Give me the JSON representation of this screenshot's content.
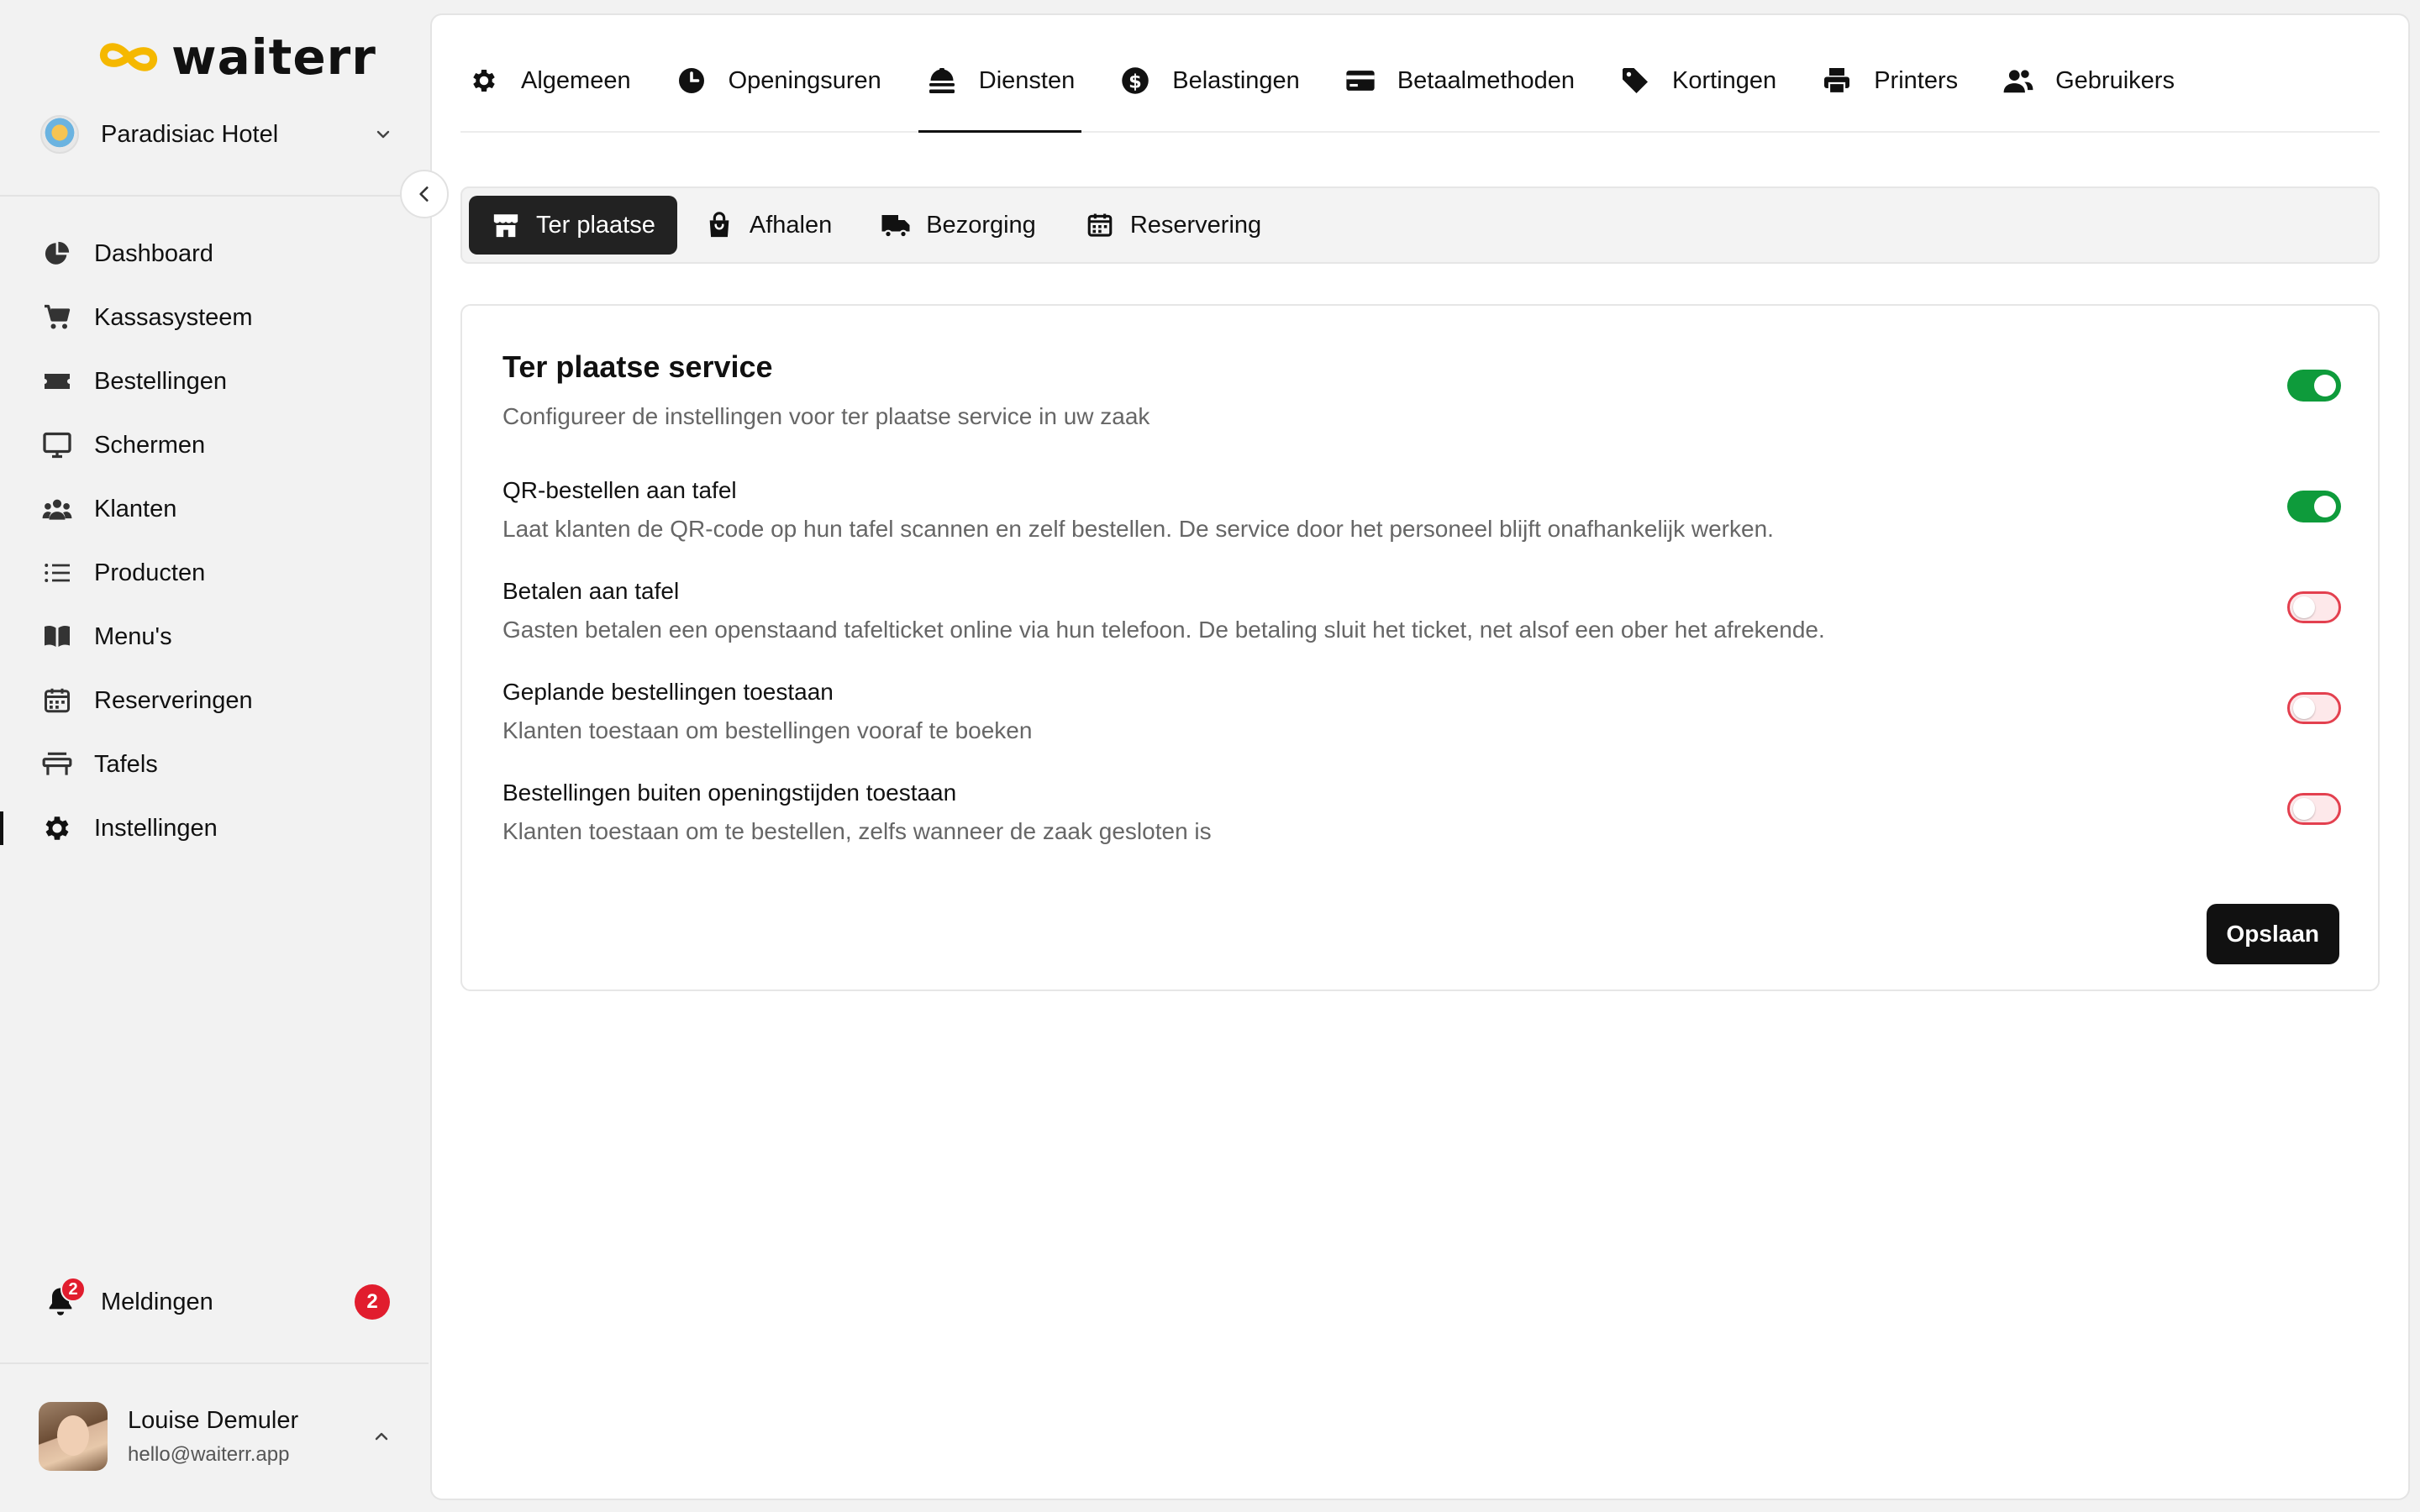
{
  "app": {
    "name": "waiterr",
    "brand_color": "#f5b800"
  },
  "sidebar": {
    "venue": {
      "name": "Paradisiac Hotel"
    },
    "items": [
      {
        "label": "Dashboard",
        "icon": "pie-chart-icon"
      },
      {
        "label": "Kassasysteem",
        "icon": "cart-icon"
      },
      {
        "label": "Bestellingen",
        "icon": "ticket-icon"
      },
      {
        "label": "Schermen",
        "icon": "monitor-icon"
      },
      {
        "label": "Klanten",
        "icon": "users-icon"
      },
      {
        "label": "Producten",
        "icon": "list-icon"
      },
      {
        "label": "Menu's",
        "icon": "book-icon"
      },
      {
        "label": "Reserveringen",
        "icon": "calendar-icon"
      },
      {
        "label": "Tafels",
        "icon": "table-icon"
      },
      {
        "label": "Instellingen",
        "icon": "gear-icon",
        "active": true
      }
    ],
    "notifications": {
      "label": "Meldingen",
      "count": "2"
    },
    "user": {
      "name": "Louise Demuler",
      "email": "hello@waiterr.app"
    }
  },
  "tabs": [
    {
      "label": "Algemeen",
      "icon": "gear-icon"
    },
    {
      "label": "Openingsuren",
      "icon": "clock-icon"
    },
    {
      "label": "Diensten",
      "icon": "cloche-icon",
      "active": true
    },
    {
      "label": "Belastingen",
      "icon": "dollar-icon"
    },
    {
      "label": "Betaalmethoden",
      "icon": "credit-card-icon"
    },
    {
      "label": "Kortingen",
      "icon": "tag-icon"
    },
    {
      "label": "Printers",
      "icon": "printer-icon"
    },
    {
      "label": "Gebruikers",
      "icon": "users-icon"
    }
  ],
  "subtabs": [
    {
      "label": "Ter plaatse",
      "icon": "store-icon",
      "active": true
    },
    {
      "label": "Afhalen",
      "icon": "shopping-bag-icon"
    },
    {
      "label": "Bezorging",
      "icon": "truck-icon"
    },
    {
      "label": "Reservering",
      "icon": "calendar-icon"
    }
  ],
  "card": {
    "title": "Ter plaatse service",
    "subtitle": "Configureer de instellingen voor ter plaatse service in uw zaak",
    "main_toggle": "on",
    "rows": [
      {
        "title": "QR-bestellen aan tafel",
        "desc": "Laat klanten de QR-code op hun tafel scannen en zelf bestellen. De service door het personeel blijft onafhankelijk werken.",
        "toggle": "on"
      },
      {
        "title": "Betalen aan tafel",
        "desc": "Gasten betalen een openstaand tafelticket online via hun telefoon. De betaling sluit het ticket, net alsof een ober het afrekende.",
        "toggle": "off"
      },
      {
        "title": "Geplande bestellingen toestaan",
        "desc": "Klanten toestaan om bestellingen vooraf te boeken",
        "toggle": "off"
      },
      {
        "title": "Bestellingen buiten openingstijden toestaan",
        "desc": "Klanten toestaan om te bestellen, zelfs wanneer de zaak gesloten is",
        "toggle": "off"
      }
    ],
    "save_label": "Opslaan"
  },
  "colors": {
    "toggle_on": "#0e9b3b",
    "toggle_off_border": "#e3404f",
    "badge": "#e11d2e"
  }
}
